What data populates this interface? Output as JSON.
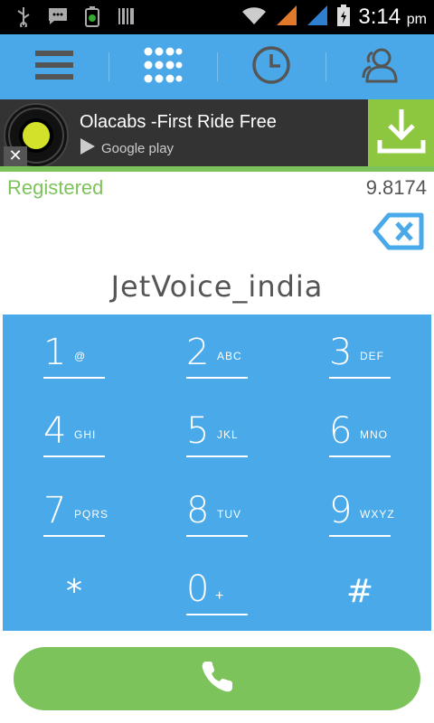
{
  "status_bar": {
    "time": "3:14",
    "ampm": "pm",
    "icons": [
      "usb-icon",
      "message-icon",
      "battery-saver-icon",
      "barcode-icon",
      "wifi-icon",
      "signal-icon",
      "signal-icon",
      "battery-icon"
    ]
  },
  "nav": {
    "items": [
      {
        "name": "menu",
        "icon": "menu-icon"
      },
      {
        "name": "dialpad",
        "icon": "dialpad-icon"
      },
      {
        "name": "history",
        "icon": "clock-icon"
      },
      {
        "name": "contacts",
        "icon": "contacts-icon"
      }
    ]
  },
  "ad": {
    "title": "Olacabs -First Ride Free",
    "store": "Google play",
    "close": "✕"
  },
  "status": {
    "registration": "Registered",
    "balance": "9.8174"
  },
  "number": "JetVoice_india",
  "keypad": {
    "keys": [
      {
        "digit": "1",
        "letters": "@"
      },
      {
        "digit": "2",
        "letters": "ABC"
      },
      {
        "digit": "3",
        "letters": "DEF"
      },
      {
        "digit": "4",
        "letters": "GHI"
      },
      {
        "digit": "5",
        "letters": "JKL"
      },
      {
        "digit": "6",
        "letters": "MNO"
      },
      {
        "digit": "7",
        "letters": "PQRS"
      },
      {
        "digit": "8",
        "letters": "TUV"
      },
      {
        "digit": "9",
        "letters": "WXYZ"
      },
      {
        "digit": "*",
        "letters": ""
      },
      {
        "digit": "0",
        "letters": "+"
      },
      {
        "digit": "#",
        "letters": ""
      }
    ]
  },
  "colors": {
    "accent": "#4aa8e8",
    "green": "#7dc35b",
    "ad_bg": "#333333"
  }
}
